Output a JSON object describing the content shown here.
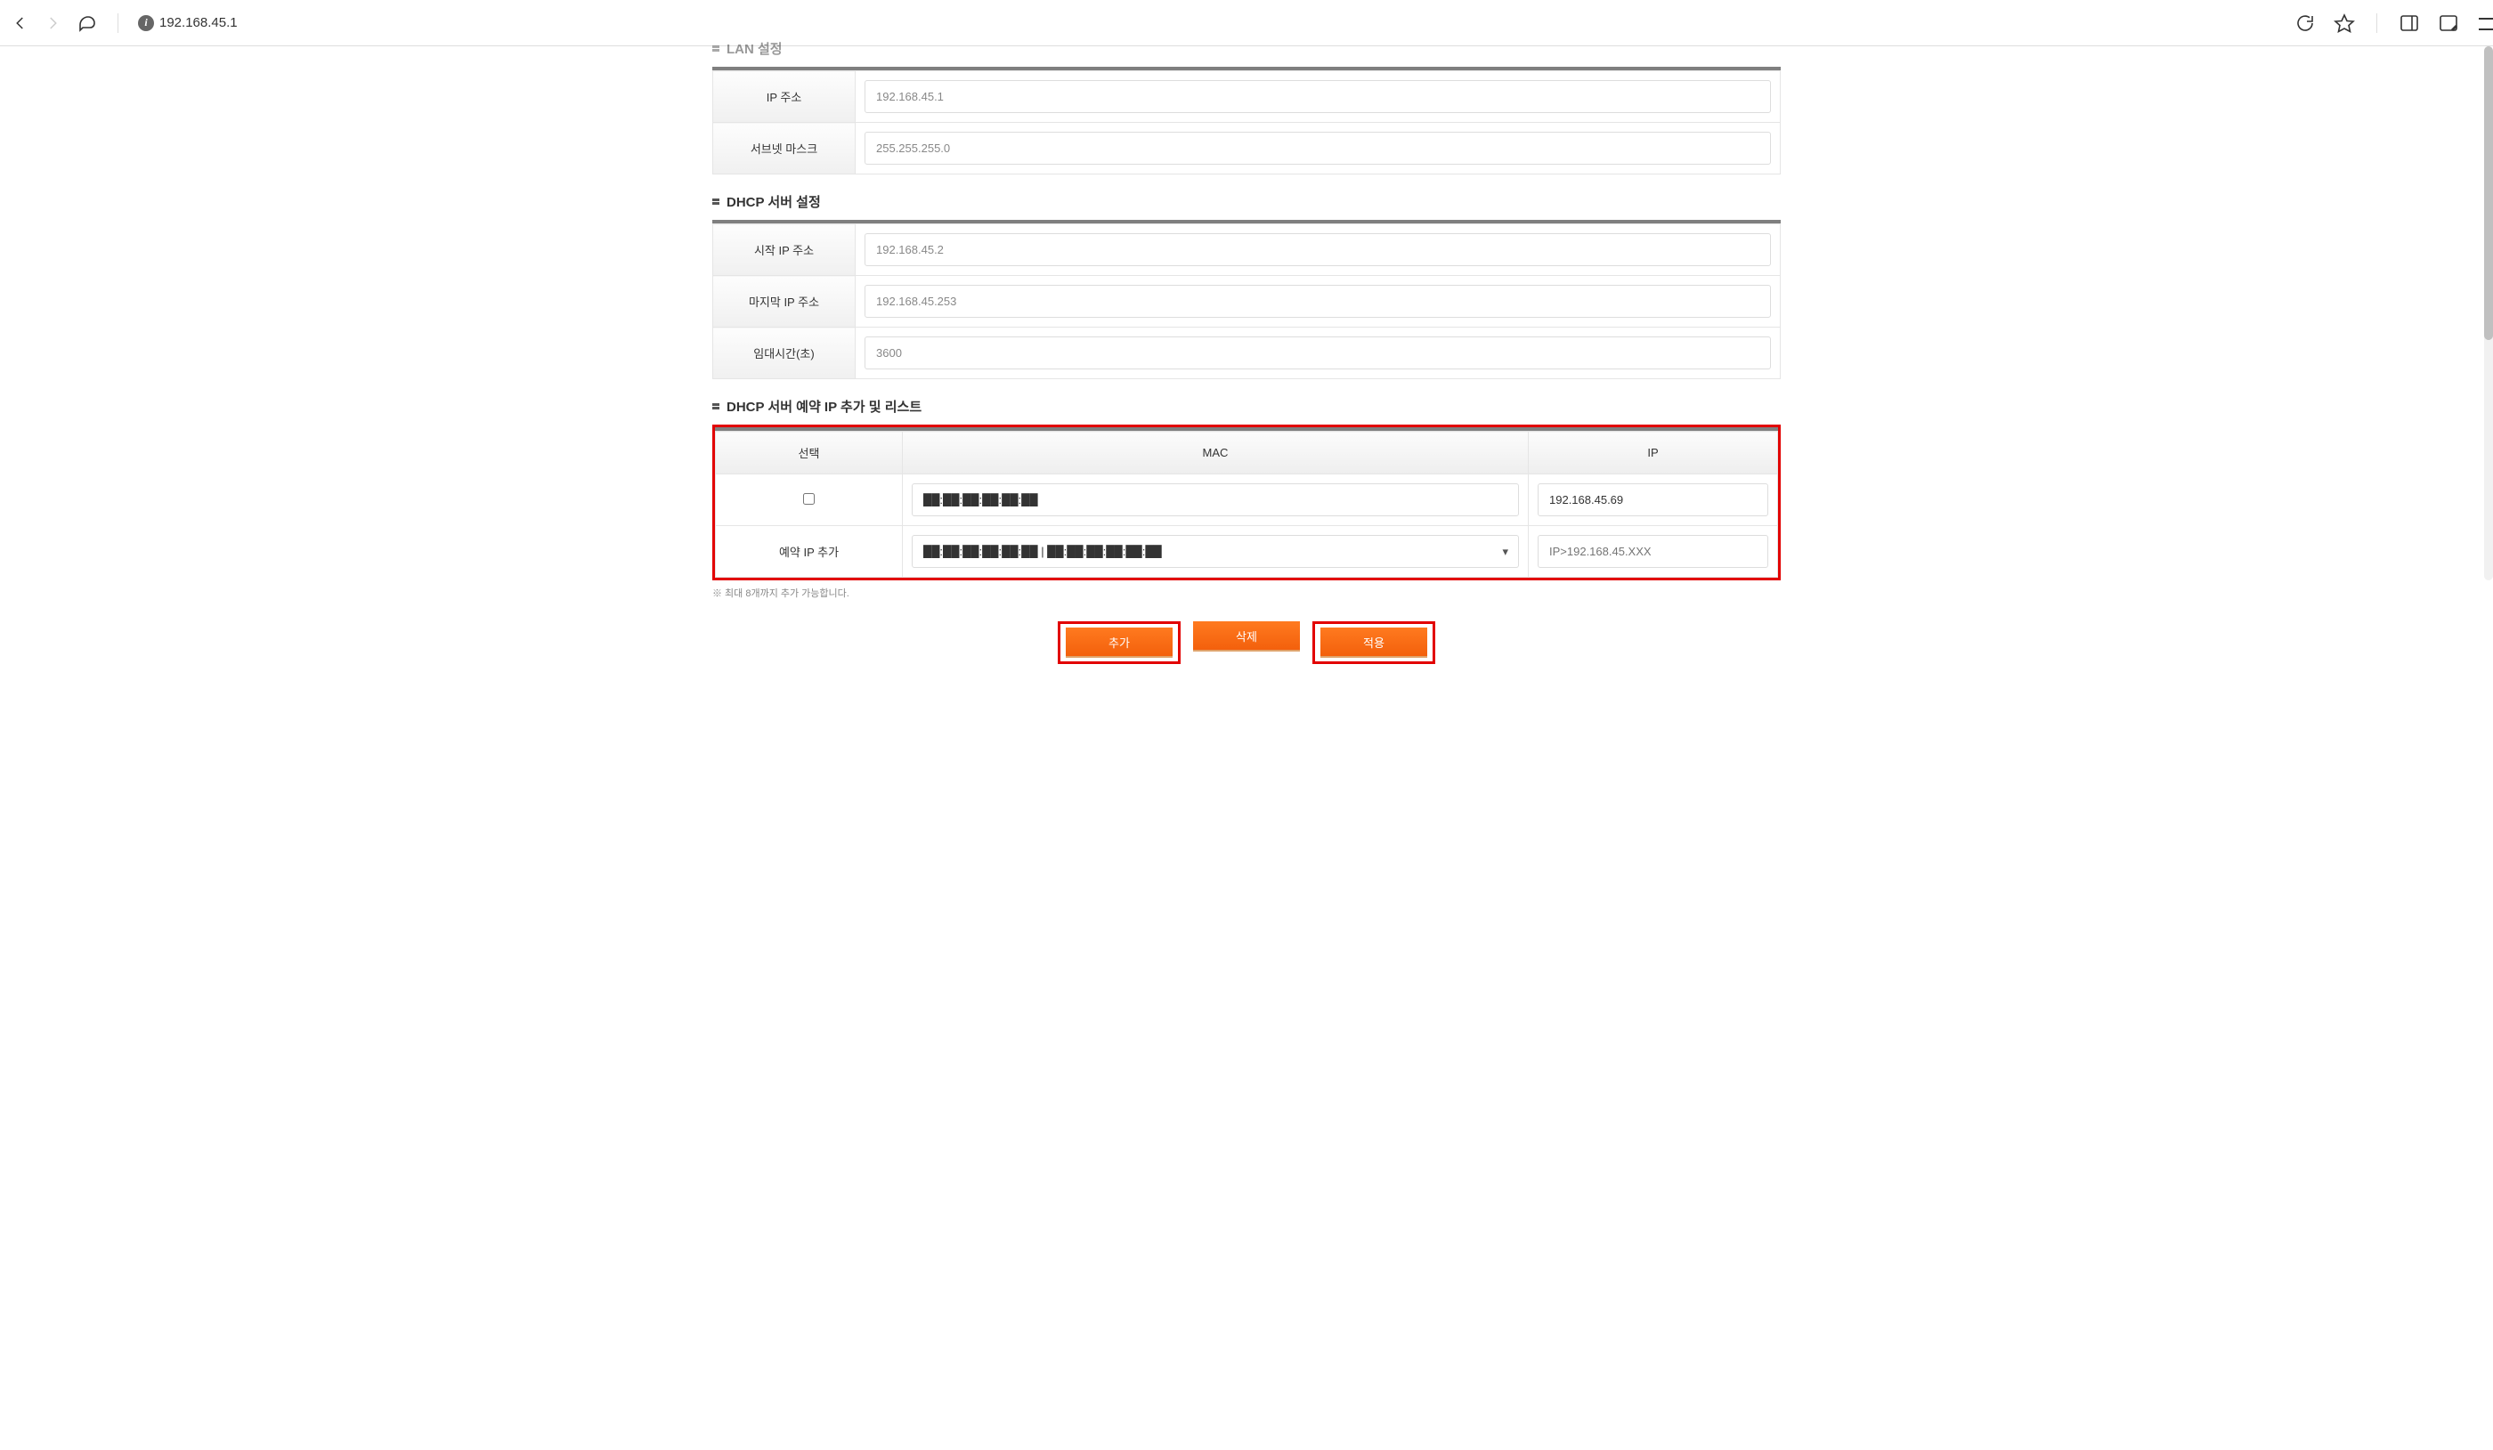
{
  "browser": {
    "url": "192.168.45.1"
  },
  "sections": {
    "lan": {
      "title": "LAN 설정",
      "ip_label": "IP 주소",
      "ip_value": "192.168.45.1",
      "mask_label": "서브넷 마스크",
      "mask_value": "255.255.255.0"
    },
    "dhcp": {
      "title": "DHCP 서버 설정",
      "start_label": "시작 IP 주소",
      "start_value": "192.168.45.2",
      "end_label": "마지막 IP 주소",
      "end_value": "192.168.45.253",
      "lease_label": "임대시간(초)",
      "lease_value": "3600"
    },
    "reserve": {
      "title": "DHCP 서버 예약 IP 추가 및 리스트",
      "col_select": "선택",
      "col_mac": "MAC",
      "col_ip": "IP",
      "rows": [
        {
          "mac": "██:██:██:██:██:██",
          "ip": "192.168.45.69"
        }
      ],
      "add_label": "예약 IP 추가",
      "add_select_value": "██:██:██:██:██:██ | ██:██:██:██:██:██",
      "add_ip_placeholder": "IP>192.168.45.XXX",
      "footnote": "※ 최대 8개까지 추가 가능합니다."
    }
  },
  "buttons": {
    "add": "추가",
    "delete": "삭제",
    "apply": "적용"
  }
}
